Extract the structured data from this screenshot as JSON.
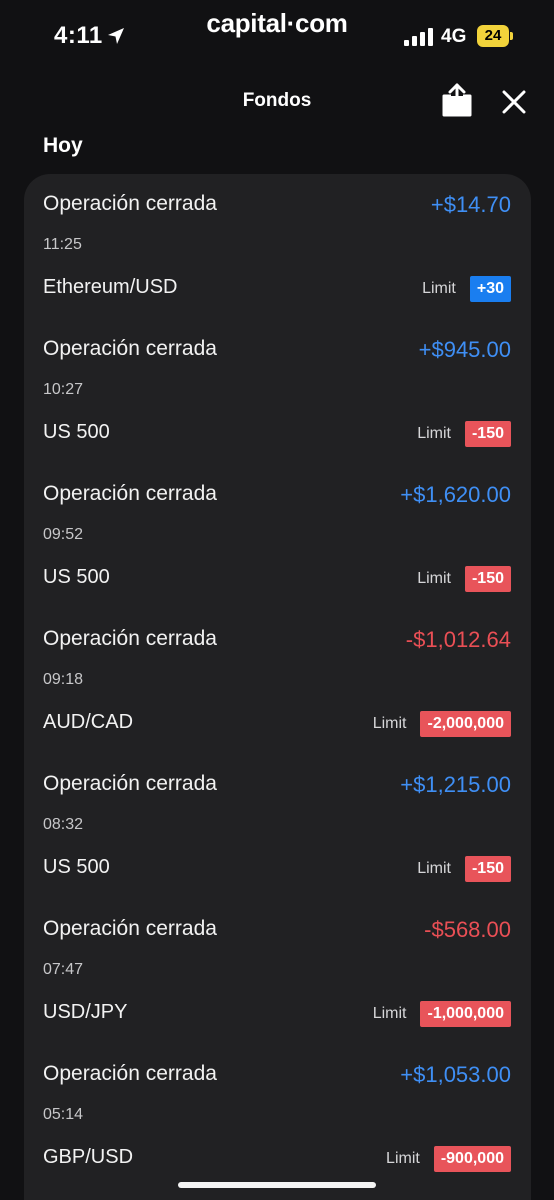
{
  "status_bar": {
    "time": "4:11",
    "brand": "capital·com",
    "network": "4G",
    "battery": "24"
  },
  "header": {
    "title": "Fondos",
    "section": "Hoy"
  },
  "transactions": [
    {
      "title": "Operación cerrada",
      "amount": "+$14.70",
      "time": "11:25",
      "instrument": "Ethereum/USD",
      "order_type": "Limit",
      "quantity": "+30"
    },
    {
      "title": "Operación cerrada",
      "amount": "+$945.00",
      "time": "10:27",
      "instrument": "US 500",
      "order_type": "Limit",
      "quantity": "-150"
    },
    {
      "title": "Operación cerrada",
      "amount": "+$1,620.00",
      "time": "09:52",
      "instrument": "US 500",
      "order_type": "Limit",
      "quantity": "-150"
    },
    {
      "title": "Operación cerrada",
      "amount": "-$1,012.64",
      "time": "09:18",
      "instrument": "AUD/CAD",
      "order_type": "Limit",
      "quantity": "-2,000,000"
    },
    {
      "title": "Operación cerrada",
      "amount": "+$1,215.00",
      "time": "08:32",
      "instrument": "US 500",
      "order_type": "Limit",
      "quantity": "-150"
    },
    {
      "title": "Operación cerrada",
      "amount": "-$568.00",
      "time": "07:47",
      "instrument": "USD/JPY",
      "order_type": "Limit",
      "quantity": "-1,000,000"
    },
    {
      "title": "Operación cerrada",
      "amount": "+$1,053.00",
      "time": "05:14",
      "instrument": "GBP/USD",
      "order_type": "Limit",
      "quantity": "-900,000"
    }
  ],
  "icons": {
    "location": "location-arrow-icon",
    "signal": "cellular-signal-icon",
    "share": "share-icon",
    "close": "close-icon"
  },
  "colors": {
    "positive": "#3f8ff5",
    "negative": "#ea4f55",
    "badge_positive": "#1a7ef0",
    "badge_negative": "#e8545a",
    "battery": "#f2d33b"
  }
}
